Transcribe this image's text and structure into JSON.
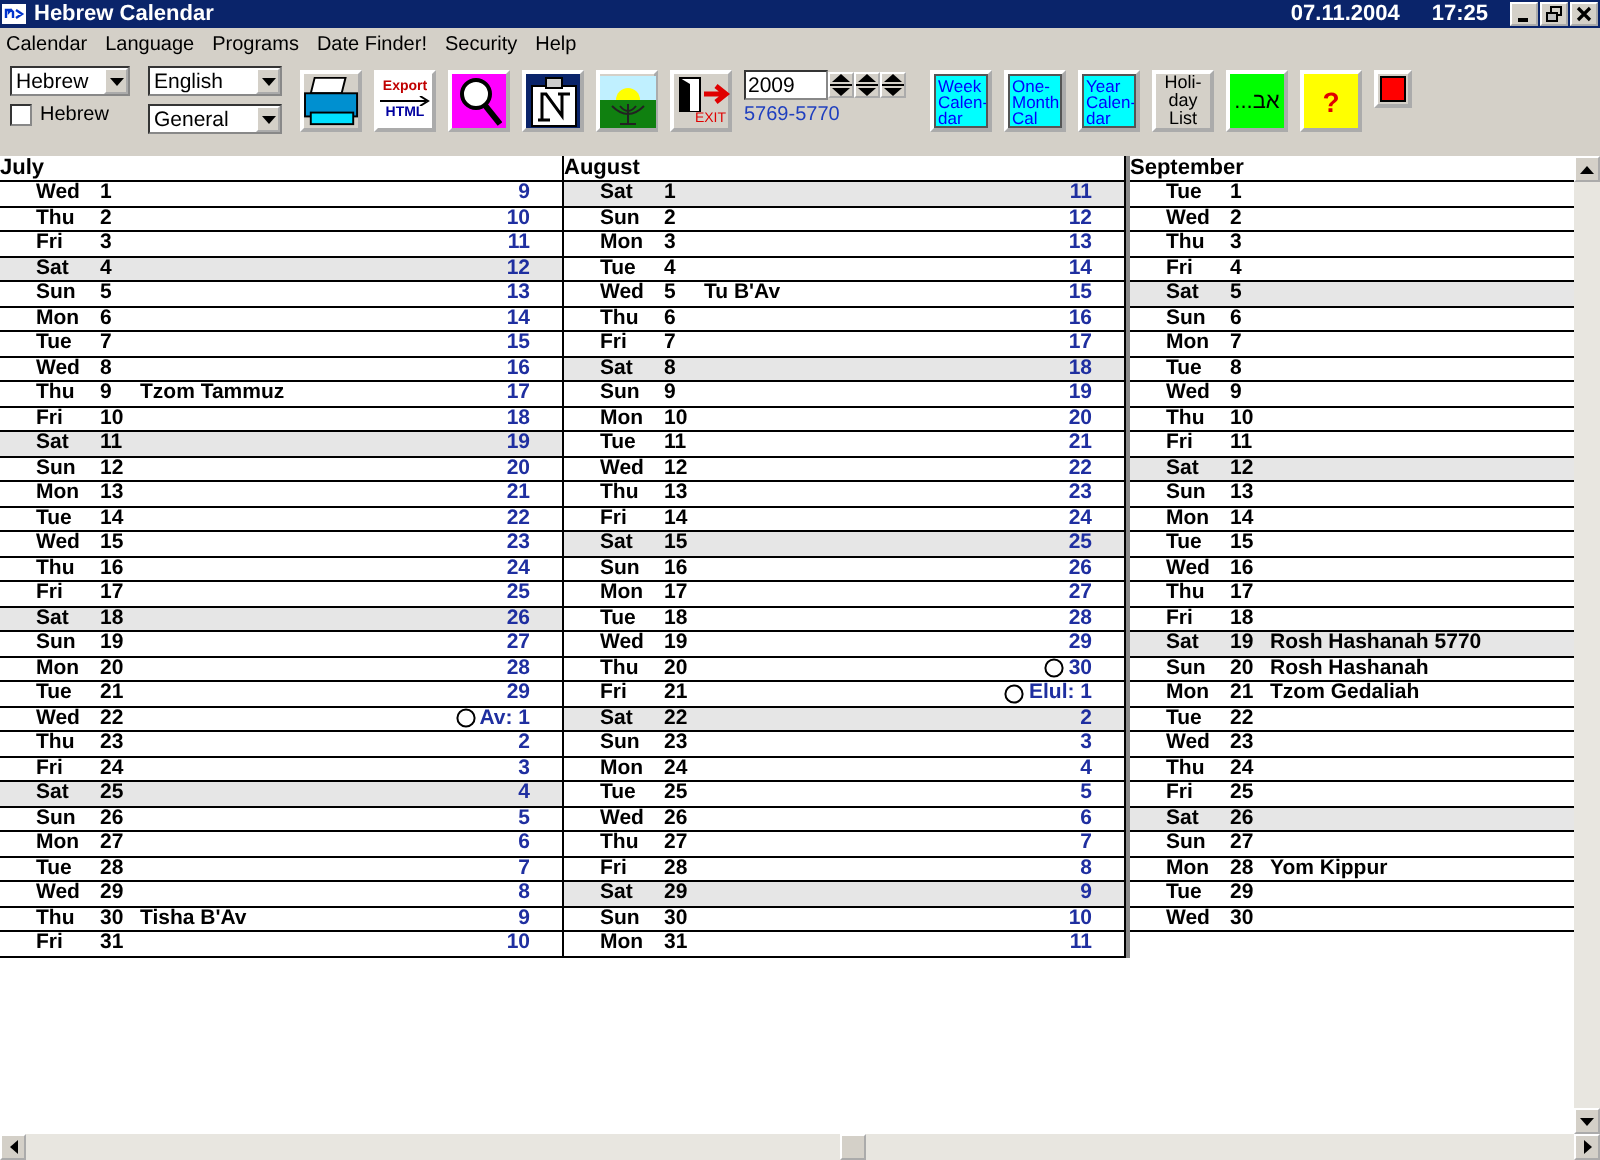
{
  "window": {
    "title": "Hebrew Calendar",
    "date": "07.11.2004",
    "time": "17:25"
  },
  "menu": [
    "Calendar",
    "Language",
    "Programs",
    "Date Finder!",
    "Security",
    "Help"
  ],
  "toolbar": {
    "calendar_select": "Hebrew",
    "language_select": "English",
    "mode_select": "General",
    "hebrew_checkbox": {
      "label": "Hebrew",
      "checked": false
    },
    "export_button": {
      "top": "Export",
      "bottom": "HTML"
    },
    "exit_label": "EXIT",
    "year": "2009",
    "hebrew_years": "5769-5770",
    "view_buttons": [
      {
        "lines": [
          "Week",
          "Calen-",
          "dar"
        ]
      },
      {
        "lines": [
          "One-",
          "Month",
          "Cal"
        ]
      },
      {
        "lines": [
          "Year",
          "Calen-",
          "dar"
        ]
      }
    ],
    "holiday_button": [
      "Holi-",
      "day",
      "List"
    ],
    "hebrew_button": "אב...",
    "help_button": "?"
  },
  "months": [
    {
      "name": "July",
      "rows": [
        {
          "weekday": "Wed",
          "day": "1",
          "hebrew": "9",
          "highlighted": false,
          "new_moon": false
        },
        {
          "weekday": "Thu",
          "day": "2",
          "hebrew": "10",
          "highlighted": false,
          "new_moon": false
        },
        {
          "weekday": "Fri",
          "day": "3",
          "hebrew": "11",
          "highlighted": false,
          "new_moon": false
        },
        {
          "weekday": "Sat",
          "day": "4",
          "hebrew": "12",
          "highlighted": true,
          "new_moon": false
        },
        {
          "weekday": "Sun",
          "day": "5",
          "hebrew": "13",
          "highlighted": false,
          "new_moon": false
        },
        {
          "weekday": "Mon",
          "day": "6",
          "hebrew": "14",
          "highlighted": false,
          "new_moon": false
        },
        {
          "weekday": "Tue",
          "day": "7",
          "hebrew": "15",
          "highlighted": false,
          "new_moon": false
        },
        {
          "weekday": "Wed",
          "day": "8",
          "hebrew": "16",
          "highlighted": false,
          "new_moon": false
        },
        {
          "weekday": "Thu",
          "day": "9",
          "event": "Tzom Tammuz",
          "hebrew": "17",
          "highlighted": false,
          "new_moon": false
        },
        {
          "weekday": "Fri",
          "day": "10",
          "hebrew": "18",
          "highlighted": false,
          "new_moon": false
        },
        {
          "weekday": "Sat",
          "day": "11",
          "hebrew": "19",
          "highlighted": true,
          "new_moon": false
        },
        {
          "weekday": "Sun",
          "day": "12",
          "hebrew": "20",
          "highlighted": false,
          "new_moon": false
        },
        {
          "weekday": "Mon",
          "day": "13",
          "hebrew": "21",
          "highlighted": false,
          "new_moon": false
        },
        {
          "weekday": "Tue",
          "day": "14",
          "hebrew": "22",
          "highlighted": false,
          "new_moon": false
        },
        {
          "weekday": "Wed",
          "day": "15",
          "hebrew": "23",
          "highlighted": false,
          "new_moon": false
        },
        {
          "weekday": "Thu",
          "day": "16",
          "hebrew": "24",
          "highlighted": false,
          "new_moon": false
        },
        {
          "weekday": "Fri",
          "day": "17",
          "hebrew": "25",
          "highlighted": false,
          "new_moon": false
        },
        {
          "weekday": "Sat",
          "day": "18",
          "hebrew": "26",
          "highlighted": true,
          "new_moon": false
        },
        {
          "weekday": "Sun",
          "day": "19",
          "hebrew": "27",
          "highlighted": false,
          "new_moon": false
        },
        {
          "weekday": "Mon",
          "day": "20",
          "hebrew": "28",
          "highlighted": false,
          "new_moon": false
        },
        {
          "weekday": "Tue",
          "day": "21",
          "hebrew": "29",
          "highlighted": false,
          "new_moon": false
        },
        {
          "weekday": "Wed",
          "day": "22",
          "hebrew": "Av: 1",
          "highlighted": false,
          "new_moon": true
        },
        {
          "weekday": "Thu",
          "day": "23",
          "hebrew": "2",
          "highlighted": false,
          "new_moon": false
        },
        {
          "weekday": "Fri",
          "day": "24",
          "hebrew": "3",
          "highlighted": false,
          "new_moon": false
        },
        {
          "weekday": "Sat",
          "day": "25",
          "hebrew": "4",
          "highlighted": true,
          "new_moon": false
        },
        {
          "weekday": "Sun",
          "day": "26",
          "hebrew": "5",
          "highlighted": false,
          "new_moon": false
        },
        {
          "weekday": "Mon",
          "day": "27",
          "hebrew": "6",
          "highlighted": false,
          "new_moon": false
        },
        {
          "weekday": "Tue",
          "day": "28",
          "hebrew": "7",
          "highlighted": false,
          "new_moon": false
        },
        {
          "weekday": "Wed",
          "day": "29",
          "hebrew": "8",
          "highlighted": false,
          "new_moon": false
        },
        {
          "weekday": "Thu",
          "day": "30",
          "event": "Tisha B'Av",
          "hebrew": "9",
          "highlighted": false,
          "new_moon": false
        },
        {
          "weekday": "Fri",
          "day": "31",
          "hebrew": "10",
          "highlighted": false,
          "new_moon": false
        }
      ]
    },
    {
      "name": "August",
      "rows": [
        {
          "weekday": "Sat",
          "day": "1",
          "hebrew": "11",
          "highlighted": true,
          "new_moon": false
        },
        {
          "weekday": "Sun",
          "day": "2",
          "hebrew": "12",
          "highlighted": false,
          "new_moon": false
        },
        {
          "weekday": "Mon",
          "day": "3",
          "hebrew": "13",
          "highlighted": false,
          "new_moon": false
        },
        {
          "weekday": "Tue",
          "day": "4",
          "hebrew": "14",
          "highlighted": false,
          "new_moon": false
        },
        {
          "weekday": "Wed",
          "day": "5",
          "event": "Tu B'Av",
          "hebrew": "15",
          "highlighted": false,
          "new_moon": false
        },
        {
          "weekday": "Thu",
          "day": "6",
          "hebrew": "16",
          "highlighted": false,
          "new_moon": false
        },
        {
          "weekday": "Fri",
          "day": "7",
          "hebrew": "17",
          "highlighted": false,
          "new_moon": false
        },
        {
          "weekday": "Sat",
          "day": "8",
          "hebrew": "18",
          "highlighted": true,
          "new_moon": false
        },
        {
          "weekday": "Sun",
          "day": "9",
          "hebrew": "19",
          "highlighted": false,
          "new_moon": false
        },
        {
          "weekday": "Mon",
          "day": "10",
          "hebrew": "20",
          "highlighted": false,
          "new_moon": false
        },
        {
          "weekday": "Tue",
          "day": "11",
          "hebrew": "21",
          "highlighted": false,
          "new_moon": false
        },
        {
          "weekday": "Wed",
          "day": "12",
          "hebrew": "22",
          "highlighted": false,
          "new_moon": false
        },
        {
          "weekday": "Thu",
          "day": "13",
          "hebrew": "23",
          "highlighted": false,
          "new_moon": false
        },
        {
          "weekday": "Fri",
          "day": "14",
          "hebrew": "24",
          "highlighted": false,
          "new_moon": false
        },
        {
          "weekday": "Sat",
          "day": "15",
          "hebrew": "25",
          "highlighted": true,
          "new_moon": false
        },
        {
          "weekday": "Sun",
          "day": "16",
          "hebrew": "26",
          "highlighted": false,
          "new_moon": false
        },
        {
          "weekday": "Mon",
          "day": "17",
          "hebrew": "27",
          "highlighted": false,
          "new_moon": false
        },
        {
          "weekday": "Tue",
          "day": "18",
          "hebrew": "28",
          "highlighted": false,
          "new_moon": false
        },
        {
          "weekday": "Wed",
          "day": "19",
          "hebrew": "29",
          "highlighted": false,
          "new_moon": false
        },
        {
          "weekday": "Thu",
          "day": "20",
          "hebrew": "30",
          "highlighted": false,
          "new_moon": true
        },
        {
          "weekday": "Fri",
          "day": "21",
          "hebrew": "Elul: 1",
          "highlighted": false,
          "new_moon": true
        },
        {
          "weekday": "Sat",
          "day": "22",
          "hebrew": "2",
          "highlighted": true,
          "new_moon": false
        },
        {
          "weekday": "Sun",
          "day": "23",
          "hebrew": "3",
          "highlighted": false,
          "new_moon": false
        },
        {
          "weekday": "Mon",
          "day": "24",
          "hebrew": "4",
          "highlighted": false,
          "new_moon": false
        },
        {
          "weekday": "Tue",
          "day": "25",
          "hebrew": "5",
          "highlighted": false,
          "new_moon": false
        },
        {
          "weekday": "Wed",
          "day": "26",
          "hebrew": "6",
          "highlighted": false,
          "new_moon": false
        },
        {
          "weekday": "Thu",
          "day": "27",
          "hebrew": "7",
          "highlighted": false,
          "new_moon": false
        },
        {
          "weekday": "Fri",
          "day": "28",
          "hebrew": "8",
          "highlighted": false,
          "new_moon": false
        },
        {
          "weekday": "Sat",
          "day": "29",
          "hebrew": "9",
          "highlighted": true,
          "new_moon": false
        },
        {
          "weekday": "Sun",
          "day": "30",
          "hebrew": "10",
          "highlighted": false,
          "new_moon": false
        },
        {
          "weekday": "Mon",
          "day": "31",
          "hebrew": "11",
          "highlighted": false,
          "new_moon": false
        }
      ]
    },
    {
      "name": "September",
      "rows": [
        {
          "weekday": "Tue",
          "day": "1",
          "highlighted": false,
          "new_moon": false
        },
        {
          "weekday": "Wed",
          "day": "2",
          "highlighted": false,
          "new_moon": false
        },
        {
          "weekday": "Thu",
          "day": "3",
          "highlighted": false,
          "new_moon": false
        },
        {
          "weekday": "Fri",
          "day": "4",
          "highlighted": false,
          "new_moon": false
        },
        {
          "weekday": "Sat",
          "day": "5",
          "highlighted": true,
          "new_moon": false
        },
        {
          "weekday": "Sun",
          "day": "6",
          "highlighted": false,
          "new_moon": false
        },
        {
          "weekday": "Mon",
          "day": "7",
          "highlighted": false,
          "new_moon": false
        },
        {
          "weekday": "Tue",
          "day": "8",
          "highlighted": false,
          "new_moon": false
        },
        {
          "weekday": "Wed",
          "day": "9",
          "highlighted": false,
          "new_moon": false
        },
        {
          "weekday": "Thu",
          "day": "10",
          "highlighted": false,
          "new_moon": false
        },
        {
          "weekday": "Fri",
          "day": "11",
          "highlighted": false,
          "new_moon": false
        },
        {
          "weekday": "Sat",
          "day": "12",
          "highlighted": true,
          "new_moon": false
        },
        {
          "weekday": "Sun",
          "day": "13",
          "highlighted": false,
          "new_moon": false
        },
        {
          "weekday": "Mon",
          "day": "14",
          "highlighted": false,
          "new_moon": false
        },
        {
          "weekday": "Tue",
          "day": "15",
          "highlighted": false,
          "new_moon": false
        },
        {
          "weekday": "Wed",
          "day": "16",
          "highlighted": false,
          "new_moon": false
        },
        {
          "weekday": "Thu",
          "day": "17",
          "highlighted": false,
          "new_moon": false
        },
        {
          "weekday": "Fri",
          "day": "18",
          "highlighted": false,
          "new_moon": false
        },
        {
          "weekday": "Sat",
          "day": "19",
          "event": "Rosh Hashanah 5770",
          "highlighted": true,
          "new_moon": false
        },
        {
          "weekday": "Sun",
          "day": "20",
          "event": "Rosh Hashanah",
          "highlighted": false,
          "new_moon": false
        },
        {
          "weekday": "Mon",
          "day": "21",
          "event": "Tzom Gedaliah",
          "highlighted": false,
          "new_moon": false
        },
        {
          "weekday": "Tue",
          "day": "22",
          "highlighted": false,
          "new_moon": false
        },
        {
          "weekday": "Wed",
          "day": "23",
          "highlighted": false,
          "new_moon": false
        },
        {
          "weekday": "Thu",
          "day": "24",
          "highlighted": false,
          "new_moon": false
        },
        {
          "weekday": "Fri",
          "day": "25",
          "highlighted": false,
          "new_moon": false
        },
        {
          "weekday": "Sat",
          "day": "26",
          "highlighted": true,
          "new_moon": false
        },
        {
          "weekday": "Sun",
          "day": "27",
          "highlighted": false,
          "new_moon": false
        },
        {
          "weekday": "Mon",
          "day": "28",
          "event": "Yom Kippur",
          "highlighted": false,
          "new_moon": false
        },
        {
          "weekday": "Tue",
          "day": "29",
          "highlighted": false,
          "new_moon": false
        },
        {
          "weekday": "Wed",
          "day": "30",
          "highlighted": false,
          "new_moon": false
        }
      ]
    }
  ]
}
